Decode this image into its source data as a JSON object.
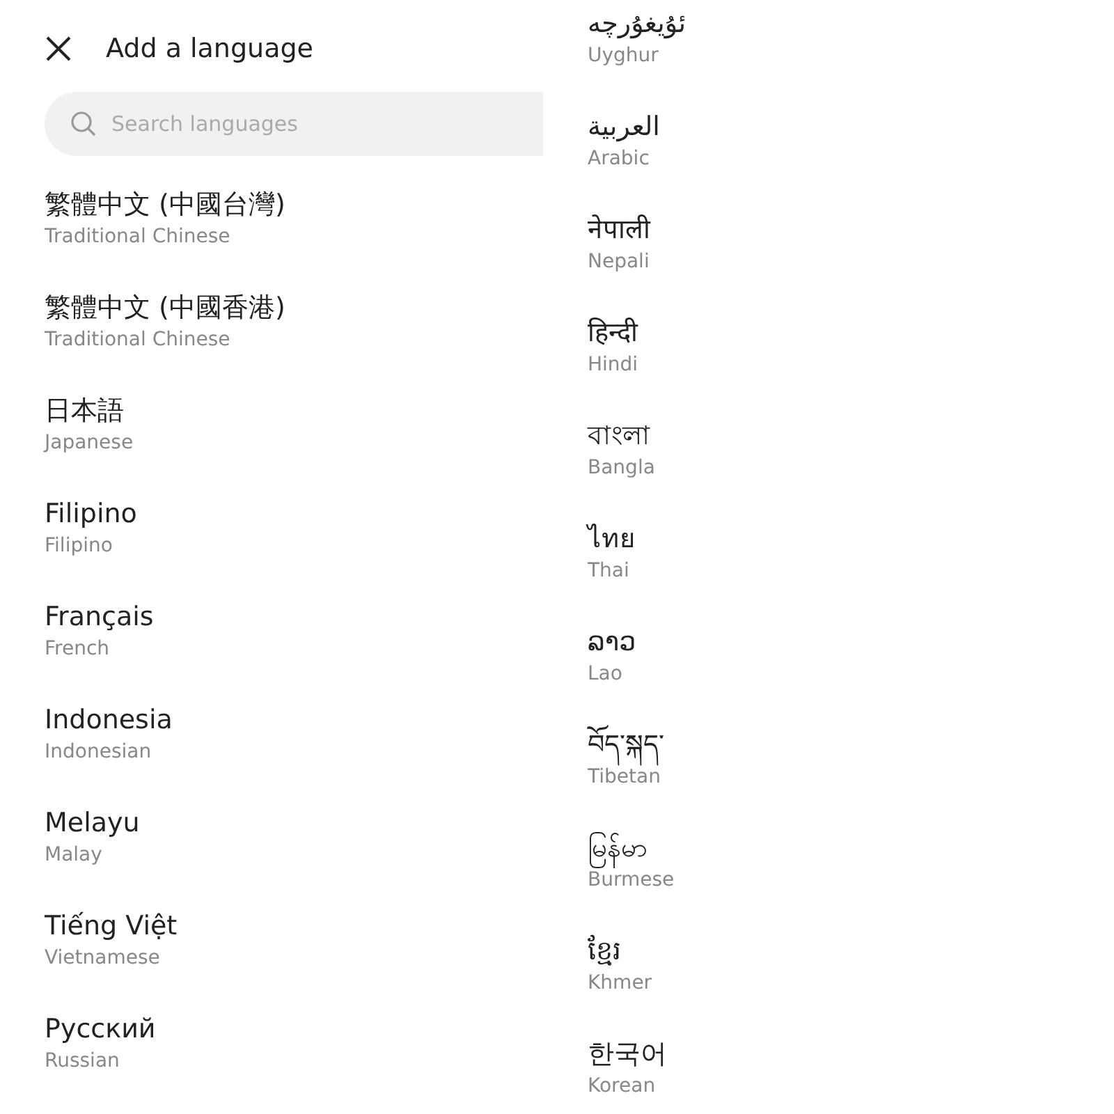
{
  "header": {
    "title": "Add a language"
  },
  "search": {
    "placeholder": "Search languages"
  },
  "languages": [
    {
      "native": "繁體中文 (中國台灣)",
      "english": "Traditional Chinese"
    },
    {
      "native": "繁體中文 (中國香港)",
      "english": "Traditional Chinese"
    },
    {
      "native": "日本語",
      "english": "Japanese"
    },
    {
      "native": "Filipino",
      "english": "Filipino"
    },
    {
      "native": "Français",
      "english": "French"
    },
    {
      "native": "Indonesia",
      "english": "Indonesian"
    },
    {
      "native": "Melayu",
      "english": "Malay"
    },
    {
      "native": "Tiếng Việt",
      "english": "Vietnamese"
    },
    {
      "native": "Русский",
      "english": "Russian"
    }
  ],
  "languages_continued": [
    {
      "native": "ئۇيغۇرچە",
      "english": "Uyghur"
    },
    {
      "native": "العربية",
      "english": "Arabic"
    },
    {
      "native": "नेपाली",
      "english": "Nepali"
    },
    {
      "native": "हिन्दी",
      "english": "Hindi"
    },
    {
      "native": "বাংলা",
      "english": "Bangla"
    },
    {
      "native": "ไทย",
      "english": "Thai"
    },
    {
      "native": "ລາວ",
      "english": "Lao"
    },
    {
      "native": "བོད་སྐད་",
      "english": "Tibetan"
    },
    {
      "native": "မြန်မာ",
      "english": "Burmese"
    },
    {
      "native": "ខ្មែរ",
      "english": "Khmer"
    },
    {
      "native": "한국어",
      "english": "Korean"
    }
  ]
}
